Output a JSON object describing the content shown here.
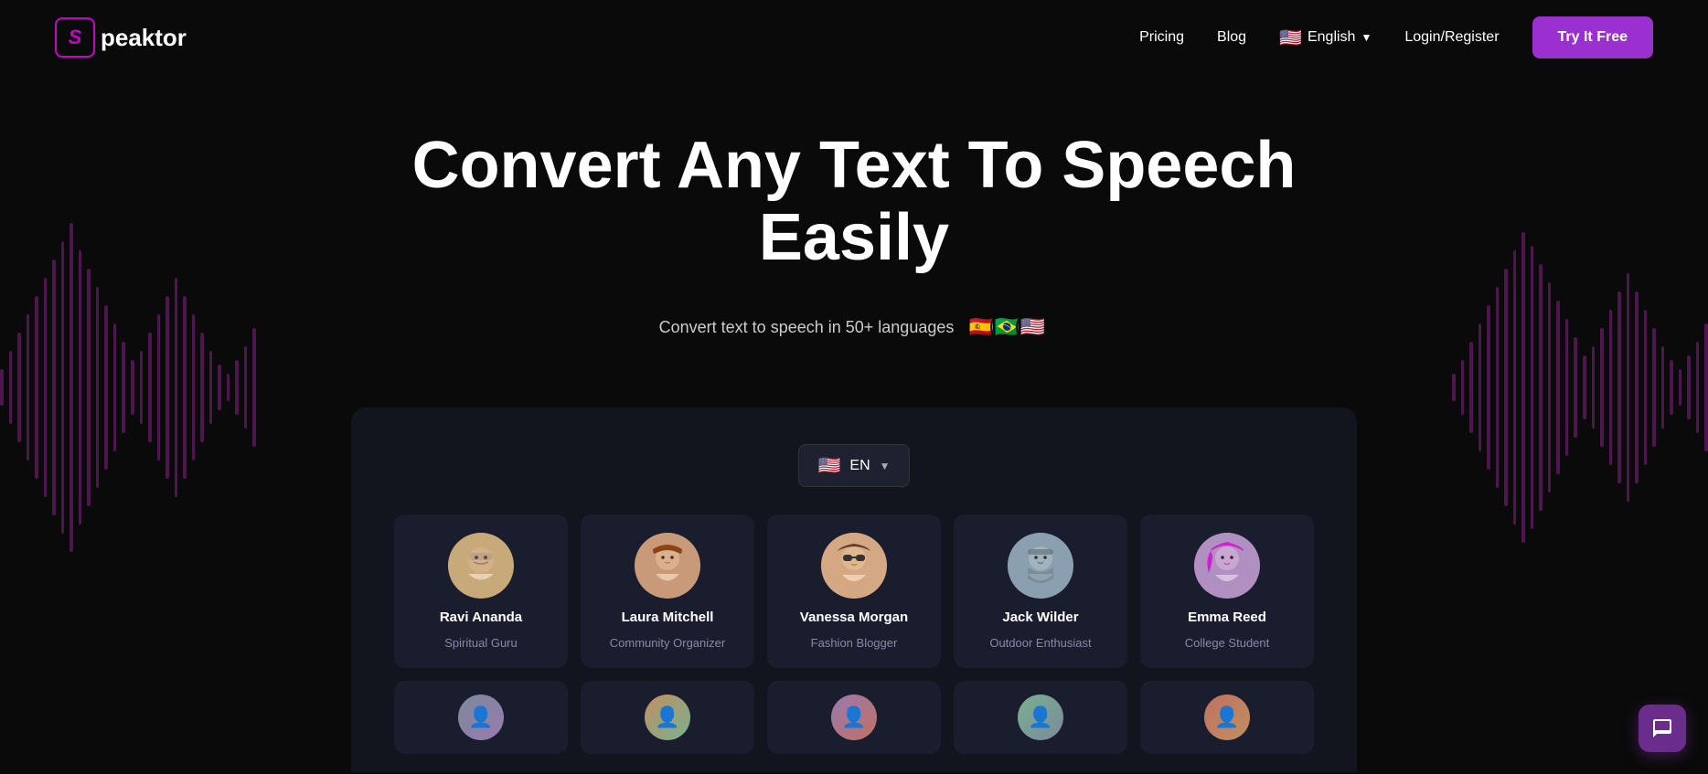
{
  "brand": {
    "logo_letter": "S",
    "logo_name": "peaktor"
  },
  "navbar": {
    "pricing_label": "Pricing",
    "blog_label": "Blog",
    "language": "English",
    "login_label": "Login/Register",
    "cta_label": "Try It Free"
  },
  "hero": {
    "title": "Convert Any Text To Speech Easily",
    "subtitle": "Convert text to speech in 50+ languages",
    "flags": [
      "🇪🇸",
      "🇧🇷",
      "🇺🇸"
    ]
  },
  "app": {
    "language_selector": "EN",
    "language_flag": "🇺🇸"
  },
  "voices": [
    {
      "name": "Ravi Ananda",
      "role": "Spiritual Guru",
      "avatar_emoji": "🧙"
    },
    {
      "name": "Laura Mitchell",
      "role": "Community Organizer",
      "avatar_emoji": "👩"
    },
    {
      "name": "Vanessa Morgan",
      "role": "Fashion Blogger",
      "avatar_emoji": "💁"
    },
    {
      "name": "Jack Wilder",
      "role": "Outdoor Enthusiast",
      "avatar_emoji": "🧔"
    },
    {
      "name": "Emma Reed",
      "role": "College Student",
      "avatar_emoji": "💇"
    }
  ],
  "wave_left_heights": [
    40,
    80,
    120,
    160,
    200,
    240,
    280,
    320,
    360,
    300,
    260,
    220,
    180,
    140,
    100,
    60,
    80,
    120,
    160,
    200,
    240,
    200,
    160,
    120,
    80,
    50,
    30,
    60,
    90,
    130
  ],
  "wave_right_heights": [
    30,
    60,
    100,
    140,
    180,
    220,
    260,
    300,
    340,
    310,
    270,
    230,
    190,
    150,
    110,
    70,
    90,
    130,
    170,
    210,
    250,
    210,
    170,
    130,
    90,
    60,
    40,
    70,
    100,
    140
  ]
}
